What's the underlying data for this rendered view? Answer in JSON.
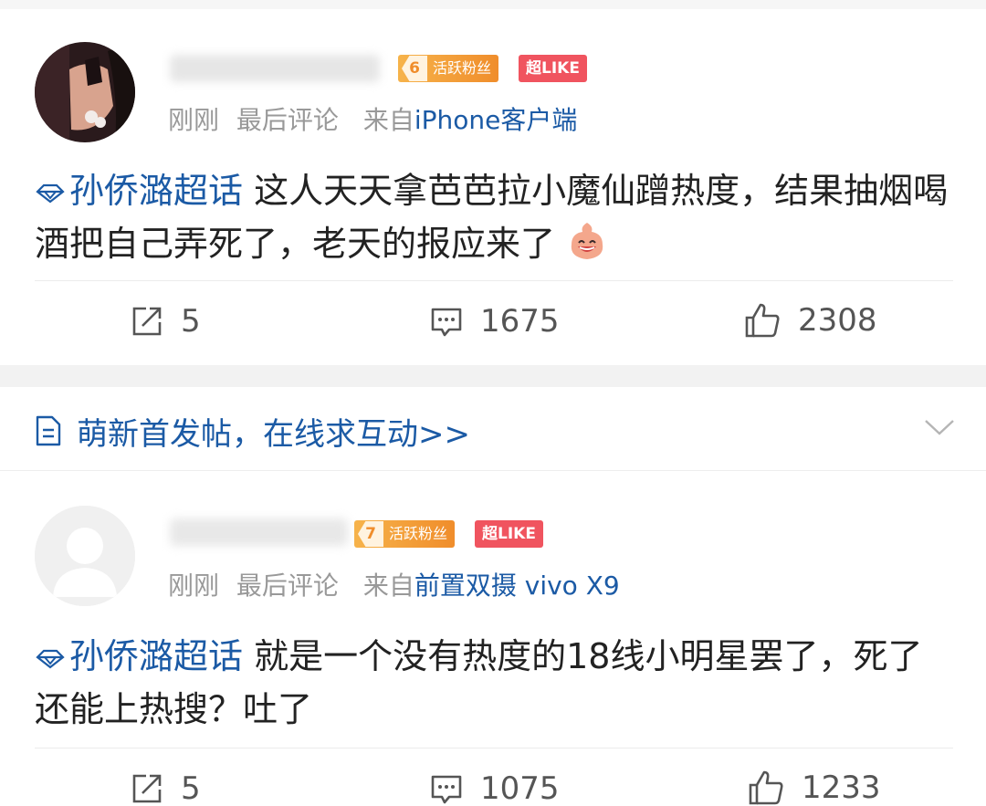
{
  "posts": [
    {
      "badges": {
        "fan_level": "6",
        "fan_label": "活跃粉丝",
        "super_like": "超LIKE"
      },
      "meta": {
        "time": "刚刚",
        "last_comment": "最后评论",
        "from_label": "来自",
        "source": "iPhone客户端"
      },
      "topic": "孙侨潞超话",
      "content": " 这人天天拿芭芭拉小魔仙蹭热度，结果抽烟喝酒把自己弄死了，老天的报应来了",
      "actions": {
        "repost": "5",
        "comment": "1675",
        "like": "2308"
      }
    },
    {
      "badges": {
        "fan_level": "7",
        "fan_label": "活跃粉丝",
        "super_like": "超LIKE"
      },
      "meta": {
        "time": "刚刚",
        "last_comment": "最后评论",
        "from_label": "来自",
        "source": "前置双摄 vivo X9"
      },
      "topic": "孙侨潞超话",
      "content": "就是一个没有热度的18线小明星罢了，死了还能上热搜？吐了",
      "actions": {
        "repost": "5",
        "comment": "1075",
        "like": "1233"
      }
    }
  ],
  "promo": {
    "text": "萌新首发帖，在线求互动>>"
  },
  "colors": {
    "link_blue": "#1b5aa5",
    "fan_badge": "#f08d2b",
    "like_badge": "#f0545f"
  }
}
